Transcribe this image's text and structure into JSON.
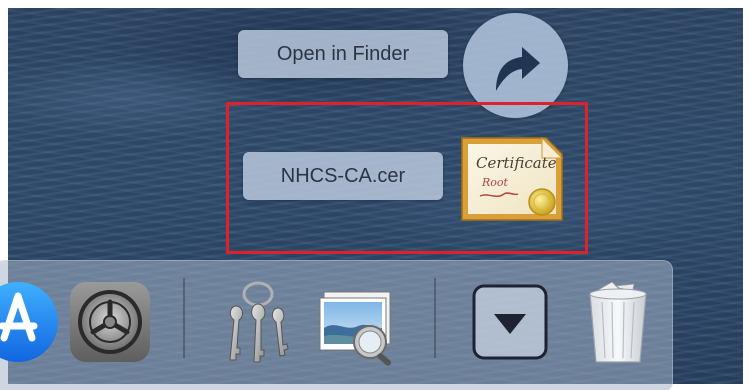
{
  "context_menu": {
    "open_in_finder_label": "Open in Finder",
    "file_name_label": "NHCS-CA.cer",
    "certificate_icon_text_1": "Certificate",
    "certificate_icon_text_2": "Root"
  },
  "icons": {
    "open_arrow": "curved-arrow-icon",
    "certificate": "certificate-file-icon"
  },
  "dock": {
    "items": [
      {
        "name": "App Store",
        "icon": "app-store-icon"
      },
      {
        "name": "System Preferences",
        "icon": "system-preferences-icon"
      },
      {
        "name": "Keychain Access",
        "icon": "keychain-access-icon"
      },
      {
        "name": "Preview",
        "icon": "preview-icon"
      },
      {
        "name": "Downloads",
        "icon": "downloads-stack-icon"
      },
      {
        "name": "Trash",
        "icon": "trash-icon"
      }
    ]
  },
  "colors": {
    "highlight_border": "#e0212a",
    "desktop_water": "#2f4a6a"
  }
}
